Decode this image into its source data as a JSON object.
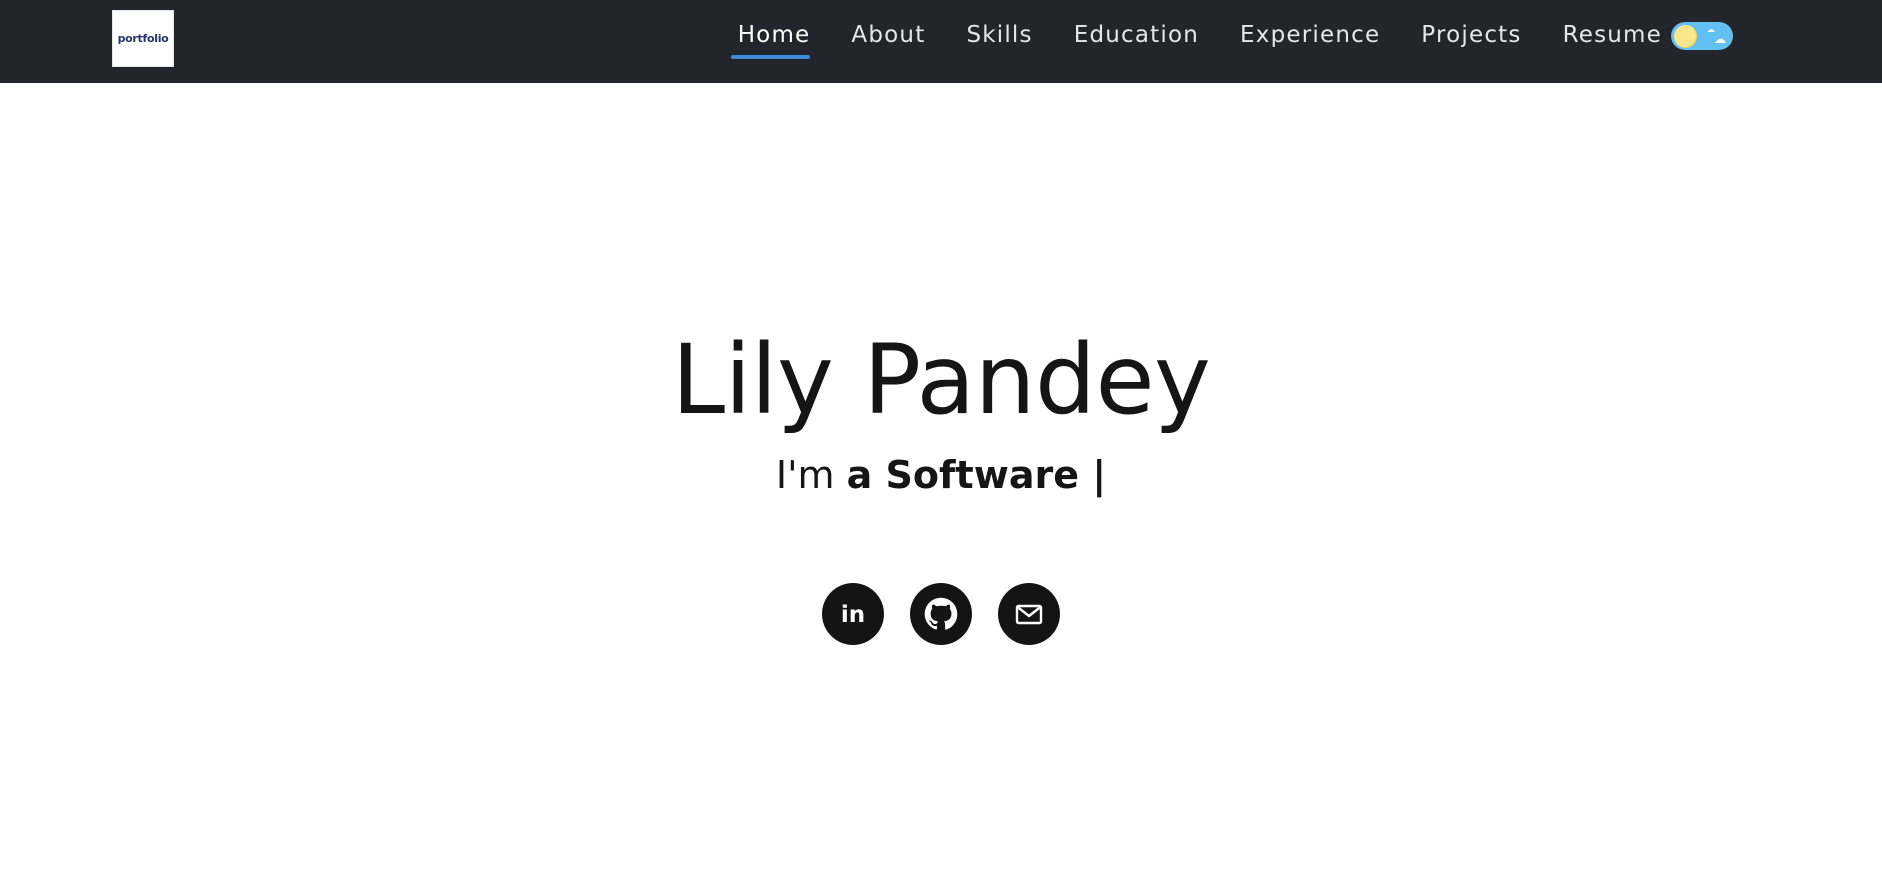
{
  "nav": {
    "logo_text": "portfolio",
    "links": [
      {
        "label": "Home",
        "active": true
      },
      {
        "label": "About"
      },
      {
        "label": "Skills"
      },
      {
        "label": "Education"
      },
      {
        "label": "Experience"
      },
      {
        "label": "Projects"
      },
      {
        "label": "Resume"
      }
    ],
    "theme_toggle": {
      "icon": "sun-cloud-toggle-icon",
      "state": "light"
    }
  },
  "hero": {
    "name": "Lily Pandey",
    "intro_prefix": "I'm",
    "typed_text": "a Software |"
  },
  "social": [
    {
      "icon": "linkedin-icon",
      "label": "in"
    },
    {
      "icon": "github-icon"
    },
    {
      "icon": "mail-icon"
    }
  ],
  "colors": {
    "navbar_bg": "#22262c",
    "active_underline": "#3d8bd8",
    "toggle_bg": "#62c0f2",
    "sun": "#fbe68b",
    "text": "#151515"
  }
}
